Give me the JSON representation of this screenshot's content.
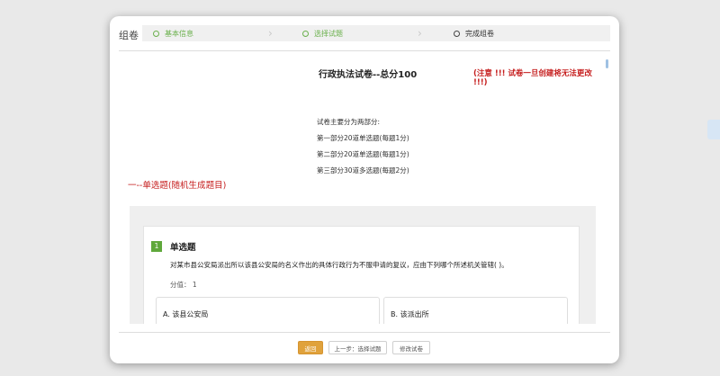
{
  "dialog": {
    "title": "组卷"
  },
  "steps": [
    {
      "label": "基本信息",
      "state": "done"
    },
    {
      "label": "选择试题",
      "state": "done"
    },
    {
      "label": "完成组卷",
      "state": "current"
    }
  ],
  "paper": {
    "title": "行政执法试卷--总分100",
    "warning": "(注意 !!! 试卷一旦创建将无法更改 !!!)",
    "intro_lines": [
      "试卷主要分为两部分:",
      "第一部分20道单选题(每题1分)",
      "第二部分20道单选题(每题1分)",
      "第三部分30道多选题(每题2分)"
    ],
    "section_heading": "一--单选题(随机生成题目)"
  },
  "question": {
    "number": "1",
    "type": "单选题",
    "text": "对某市县公安局派出所以该县公安局的名义作出的具体行政行为不服申请的复议，应由下列哪个所述机关管辖(     )。",
    "score_label": "分值：",
    "score_value": "1",
    "options": [
      {
        "label": "A.  该县公安局"
      },
      {
        "label": "B.  该派出所"
      }
    ]
  },
  "footer": {
    "back_label": "返回",
    "prev_label": "上一步：选择试题",
    "edit_label": "修改试卷"
  },
  "colors": {
    "done_step": "#6ab04c",
    "warning_red": "#c51c1c",
    "primary_button": "#e0a23c",
    "question_badge": "#5fa83b"
  },
  "icons": {
    "step_status": "circle-icon",
    "step_separator": "chevron-right-icon"
  }
}
